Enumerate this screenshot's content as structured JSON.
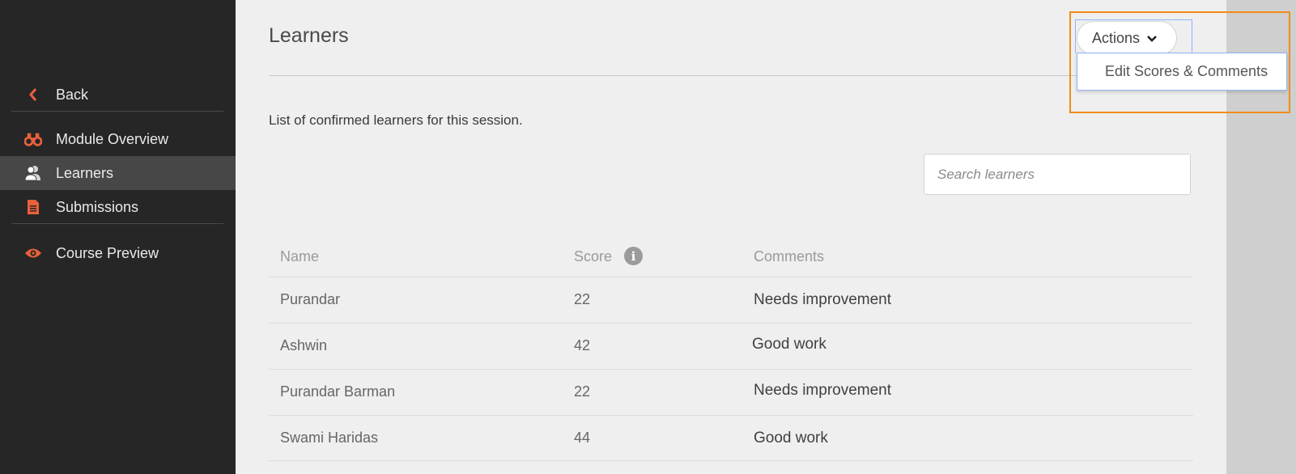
{
  "sidebar": {
    "back": "Back",
    "items": [
      {
        "label": "Module Overview",
        "icon": "binoculars-icon"
      },
      {
        "label": "Learners",
        "icon": "users-icon",
        "active": true
      },
      {
        "label": "Submissions",
        "icon": "document-icon"
      },
      {
        "label": "Course Preview",
        "icon": "eye-icon"
      }
    ]
  },
  "header": {
    "title": "Learners",
    "actions_label": "Actions",
    "actions_menu": [
      "Edit Scores & Comments"
    ]
  },
  "main": {
    "intro": "List of confirmed learners for this session.",
    "search_placeholder": "Search learners"
  },
  "table": {
    "columns": [
      "Name",
      "Score",
      "Comments"
    ],
    "rows": [
      {
        "name": "Purandar",
        "score": "22",
        "comment": "Needs improvement"
      },
      {
        "name": "Ashwin",
        "score": "42",
        "comment": "Good work"
      },
      {
        "name": "Purandar Barman",
        "score": "22",
        "comment": "Needs improvement"
      },
      {
        "name": "Swami Haridas",
        "score": "44",
        "comment": "Good work"
      }
    ]
  },
  "colors": {
    "accent": "#e8603c",
    "sidebar_bg": "#262626",
    "highlight": "#f08c1a"
  }
}
